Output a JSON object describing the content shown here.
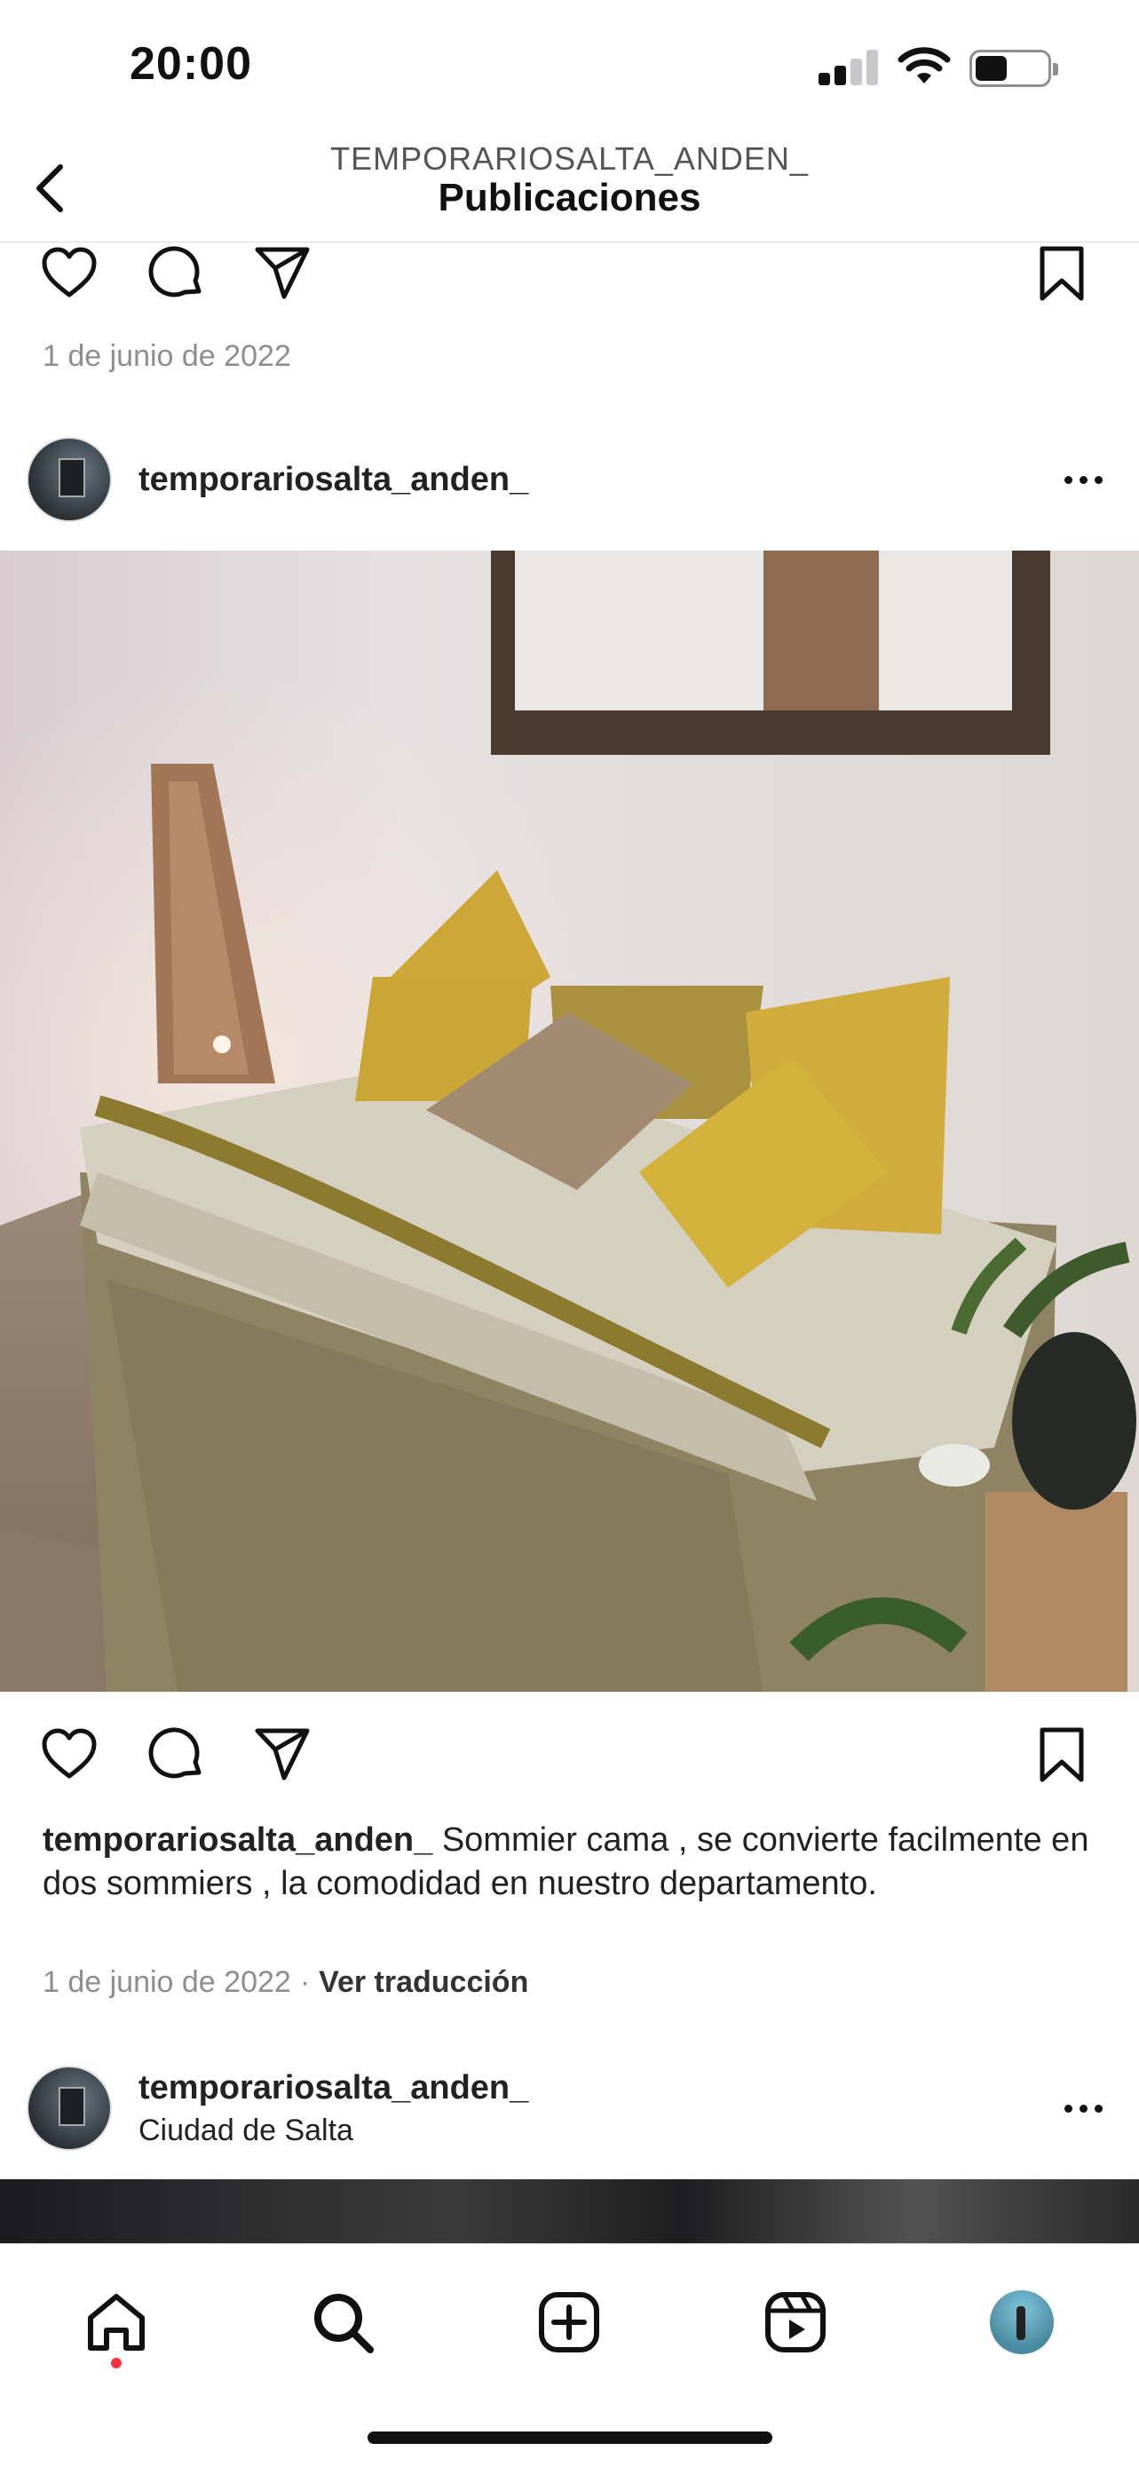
{
  "status_bar": {
    "time": "20:00",
    "battery_level": 0.42
  },
  "header": {
    "account": "TEMPORARIOSALTA_ANDEN_",
    "title": "Publicaciones",
    "back_icon": "chevron-left-icon"
  },
  "previous_post": {
    "date": "1 de junio de 2022"
  },
  "post": {
    "username": "temporariosalta_anden_",
    "image_alt": "Sommier cama con almohadones amarillos",
    "caption_user": "temporariosalta_anden_",
    "caption_text": "Sommier cama , se convierte facilmente en dos sommiers , la comodidad en nuestro departamento.",
    "date": "1 de junio de 2022",
    "separator": "·",
    "translate_label": "Ver traducción"
  },
  "next_post": {
    "username": "temporariosalta_anden_",
    "location": "Ciudad de Salta"
  },
  "actions": [
    "heart-icon",
    "comment-icon",
    "share-icon",
    "bookmark-icon"
  ],
  "tab_bar": {
    "items": [
      "home-icon",
      "search-icon",
      "create-icon",
      "reels-icon",
      "profile-avatar"
    ],
    "home_notification": true
  },
  "colors": {
    "accent_dot": "#ff3040",
    "muted_text": "#8e8e8e"
  }
}
